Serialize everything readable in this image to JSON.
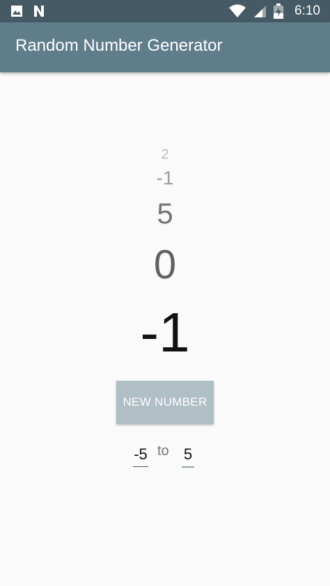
{
  "status_bar": {
    "time": "6:10",
    "icons": [
      "image-icon",
      "n-notification-icon",
      "wifi-icon",
      "cell-signal-icon",
      "battery-charging-icon"
    ]
  },
  "app_bar": {
    "title": "Random Number Generator"
  },
  "history": [
    "2",
    "-1",
    "5",
    "0"
  ],
  "current_number": "-1",
  "new_number_button": "NEW NUMBER",
  "range": {
    "min": "-5",
    "separator": "to",
    "max": "5"
  },
  "colors": {
    "status_bar": "#455a64",
    "app_bar": "#607d8b",
    "button": "#b0bec5",
    "accent_underline": "#90a4ae"
  }
}
